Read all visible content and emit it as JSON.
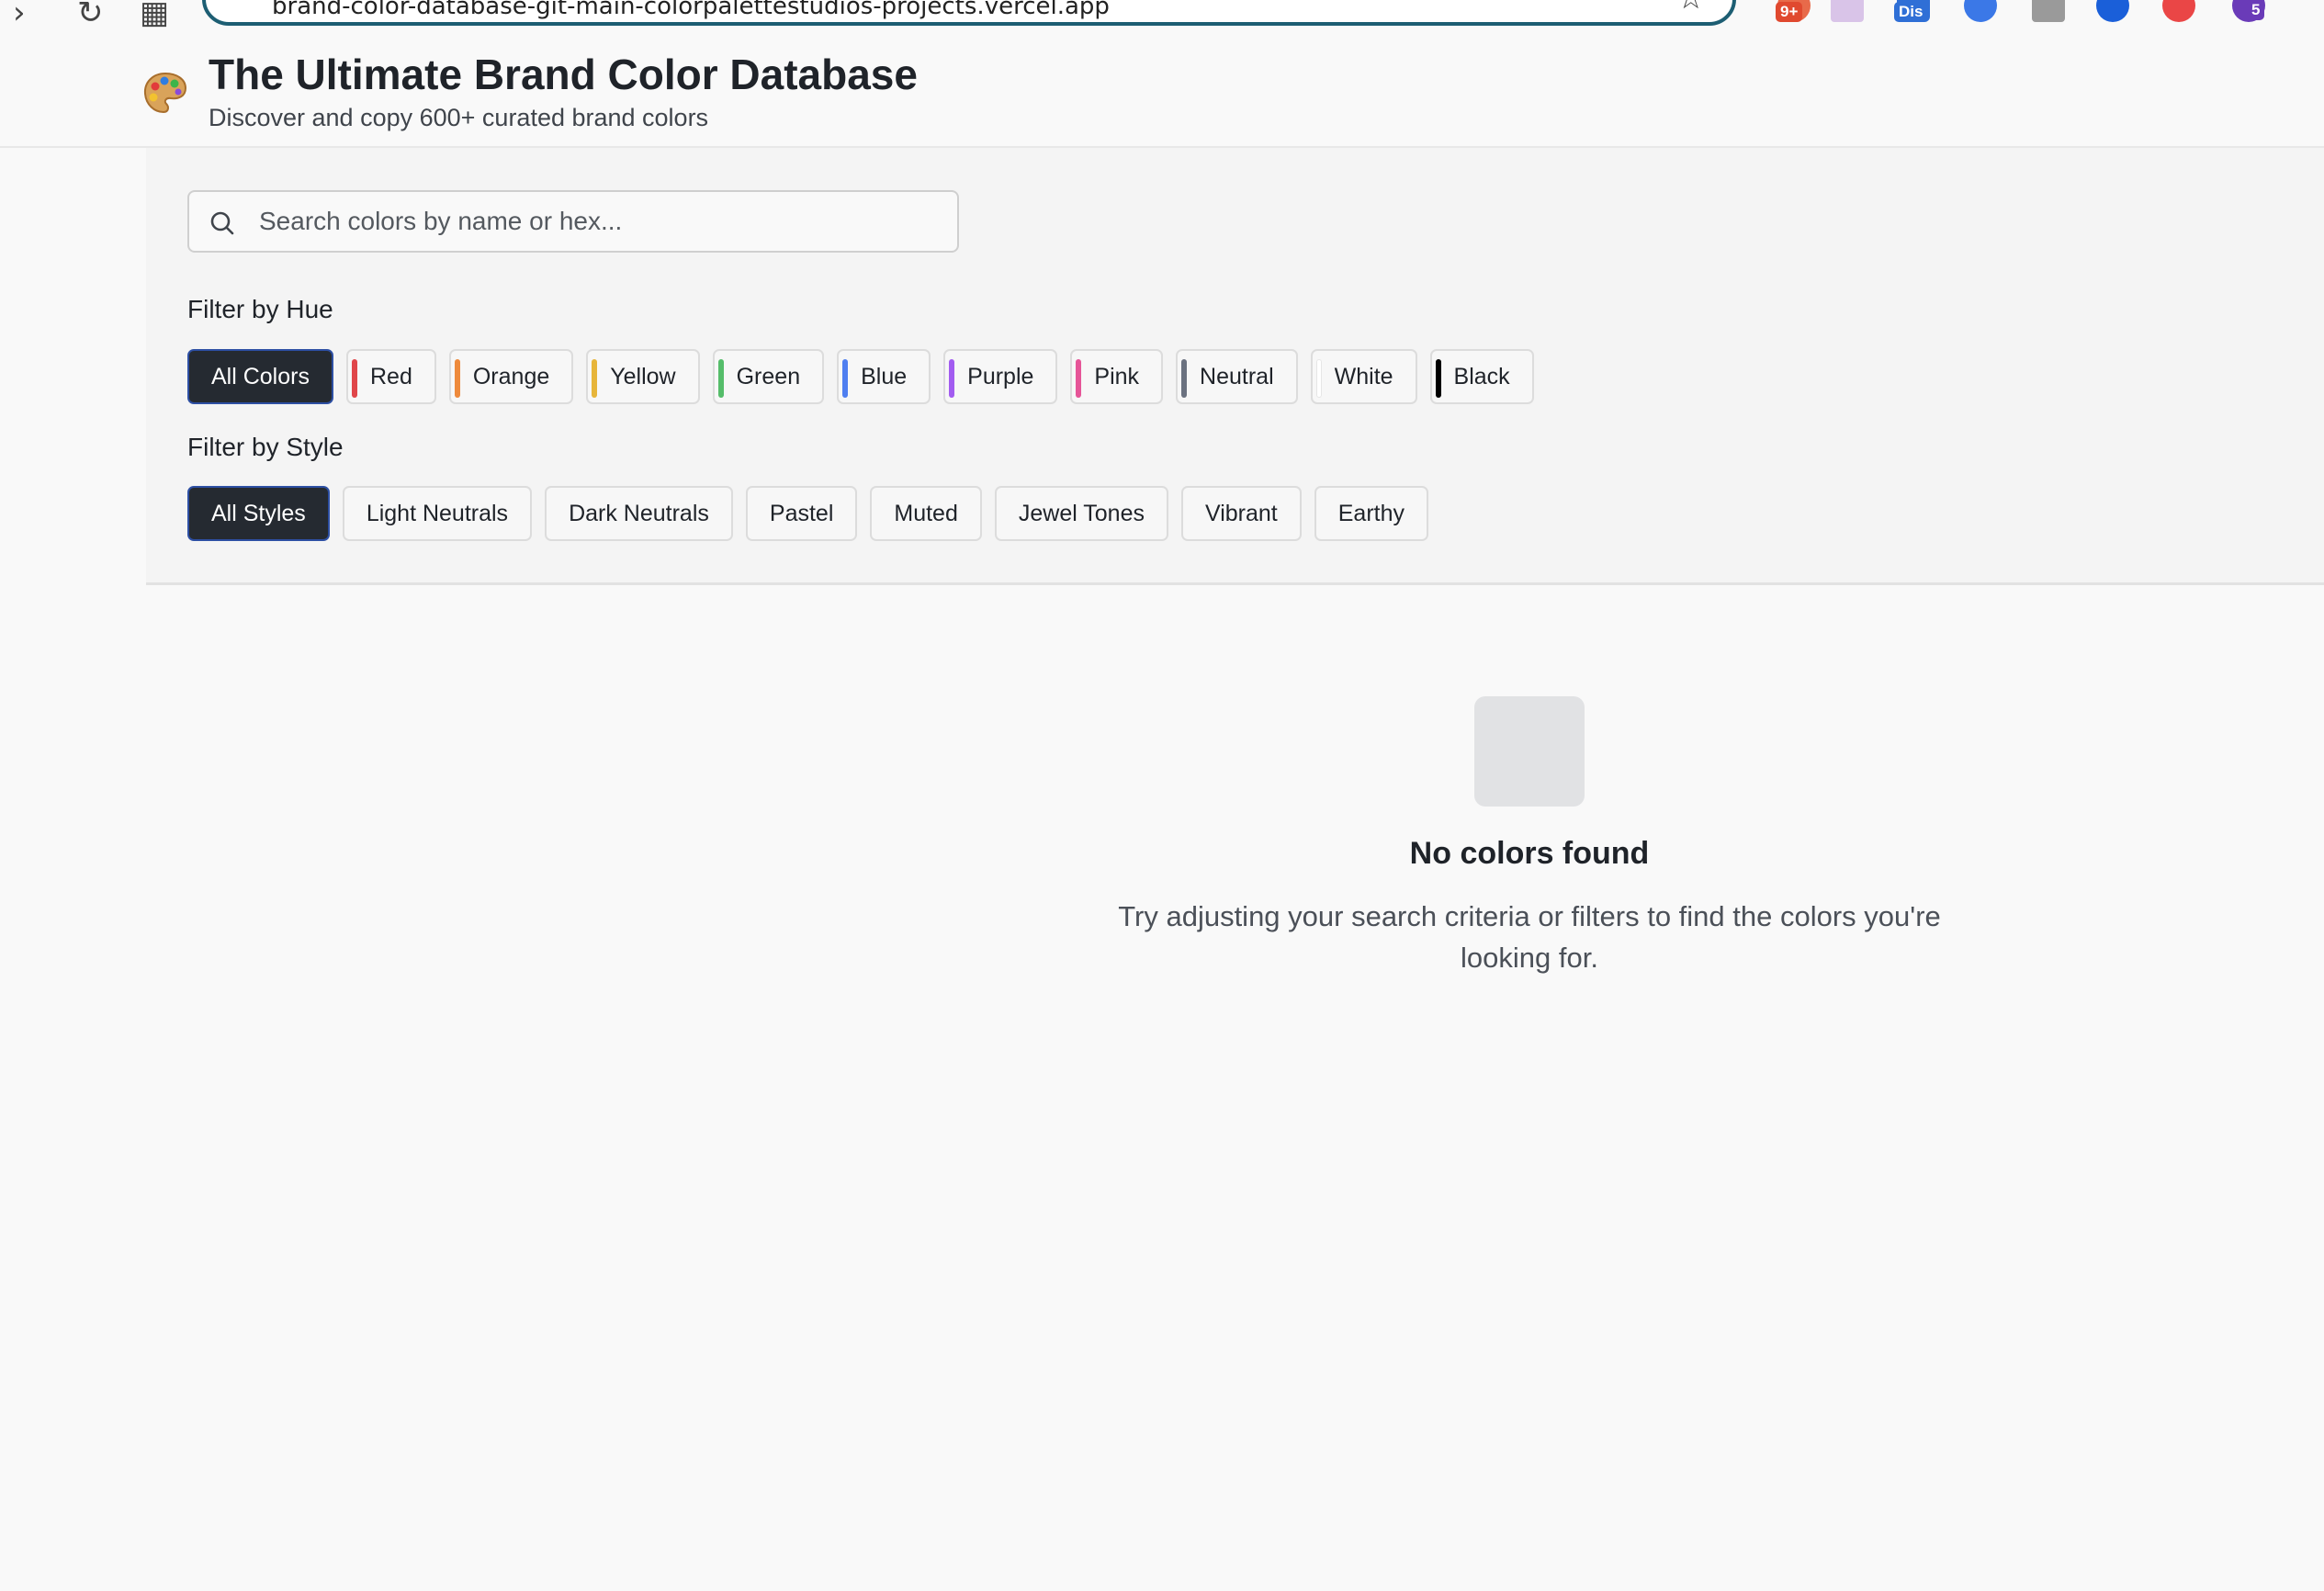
{
  "browser": {
    "url": "brand-color-database-git-main-colorpalettestudios-projects.vercel.app",
    "extension_badges": [
      "9+",
      "Dis",
      "5"
    ]
  },
  "header": {
    "title": "The Ultimate Brand Color Database",
    "subtitle": "Discover and copy 600+ curated brand colors"
  },
  "search": {
    "placeholder": "Search colors by name or hex...",
    "value": ""
  },
  "hue_filter": {
    "label": "Filter by Hue",
    "selected": "All Colors",
    "options": [
      {
        "label": "All Colors",
        "color": ""
      },
      {
        "label": "Red",
        "color": "#e0464a"
      },
      {
        "label": "Orange",
        "color": "#ee8a3c"
      },
      {
        "label": "Yellow",
        "color": "#e7b53a"
      },
      {
        "label": "Green",
        "color": "#55bd6a"
      },
      {
        "label": "Blue",
        "color": "#4f7ff0"
      },
      {
        "label": "Purple",
        "color": "#a25cf0"
      },
      {
        "label": "Pink",
        "color": "#e65598"
      },
      {
        "label": "Neutral",
        "color": "#6b7280"
      },
      {
        "label": "White",
        "color": "#ffffff"
      },
      {
        "label": "Black",
        "color": "#000000"
      }
    ]
  },
  "style_filter": {
    "label": "Filter by Style",
    "selected": "All Styles",
    "options": [
      "All Styles",
      "Light Neutrals",
      "Dark Neutrals",
      "Pastel",
      "Muted",
      "Jewel Tones",
      "Vibrant",
      "Earthy"
    ]
  },
  "empty_state": {
    "title": "No colors found",
    "description": "Try adjusting your search criteria or filters to find the colors you're looking for."
  },
  "colors": {
    "active_chip_bg": "#252a31",
    "active_chip_border": "#2d4fa3",
    "page_bg": "#f9f9f9",
    "panel_bg": "#f4f4f4"
  }
}
